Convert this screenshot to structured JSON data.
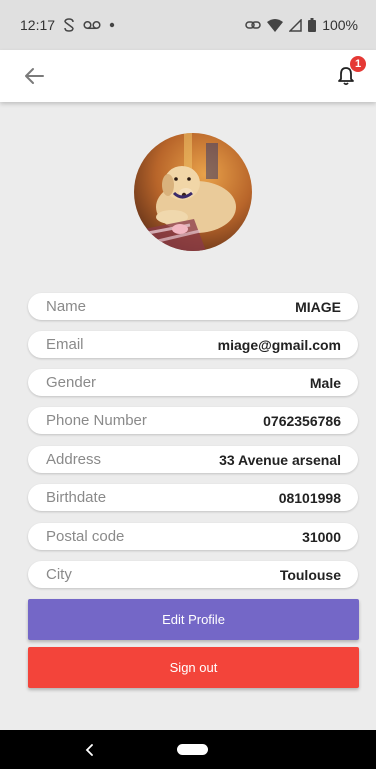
{
  "status_bar": {
    "time": "12:17",
    "left_icons": [
      "sync-icon",
      "voicemail-icon",
      "dot-icon"
    ],
    "right_icons": [
      "link-icon",
      "wifi-icon",
      "signal-icon",
      "battery-icon"
    ],
    "battery": "100%"
  },
  "app_bar": {
    "back_icon": "arrow-left-icon",
    "bell_icon": "bell-icon",
    "notification_count": "1"
  },
  "profile": {
    "avatar": "dog-photo-avatar",
    "fields": [
      {
        "label": "Name",
        "value": "MIAGE"
      },
      {
        "label": "Email",
        "value": "miage@gmail.com"
      },
      {
        "label": "Gender",
        "value": "Male"
      },
      {
        "label": "Phone Number",
        "value": "0762356786"
      },
      {
        "label": "Address",
        "value": "33 Avenue arsenal"
      },
      {
        "label": "Birthdate",
        "value": "08101998"
      },
      {
        "label": "Postal code",
        "value": "31000"
      },
      {
        "label": "City",
        "value": "Toulouse"
      }
    ]
  },
  "actions": {
    "edit_label": "Edit Profile",
    "signout_label": "Sign out"
  },
  "colors": {
    "edit_button": "#7467c7",
    "signout_button": "#f3443a",
    "badge": "#e53935"
  }
}
